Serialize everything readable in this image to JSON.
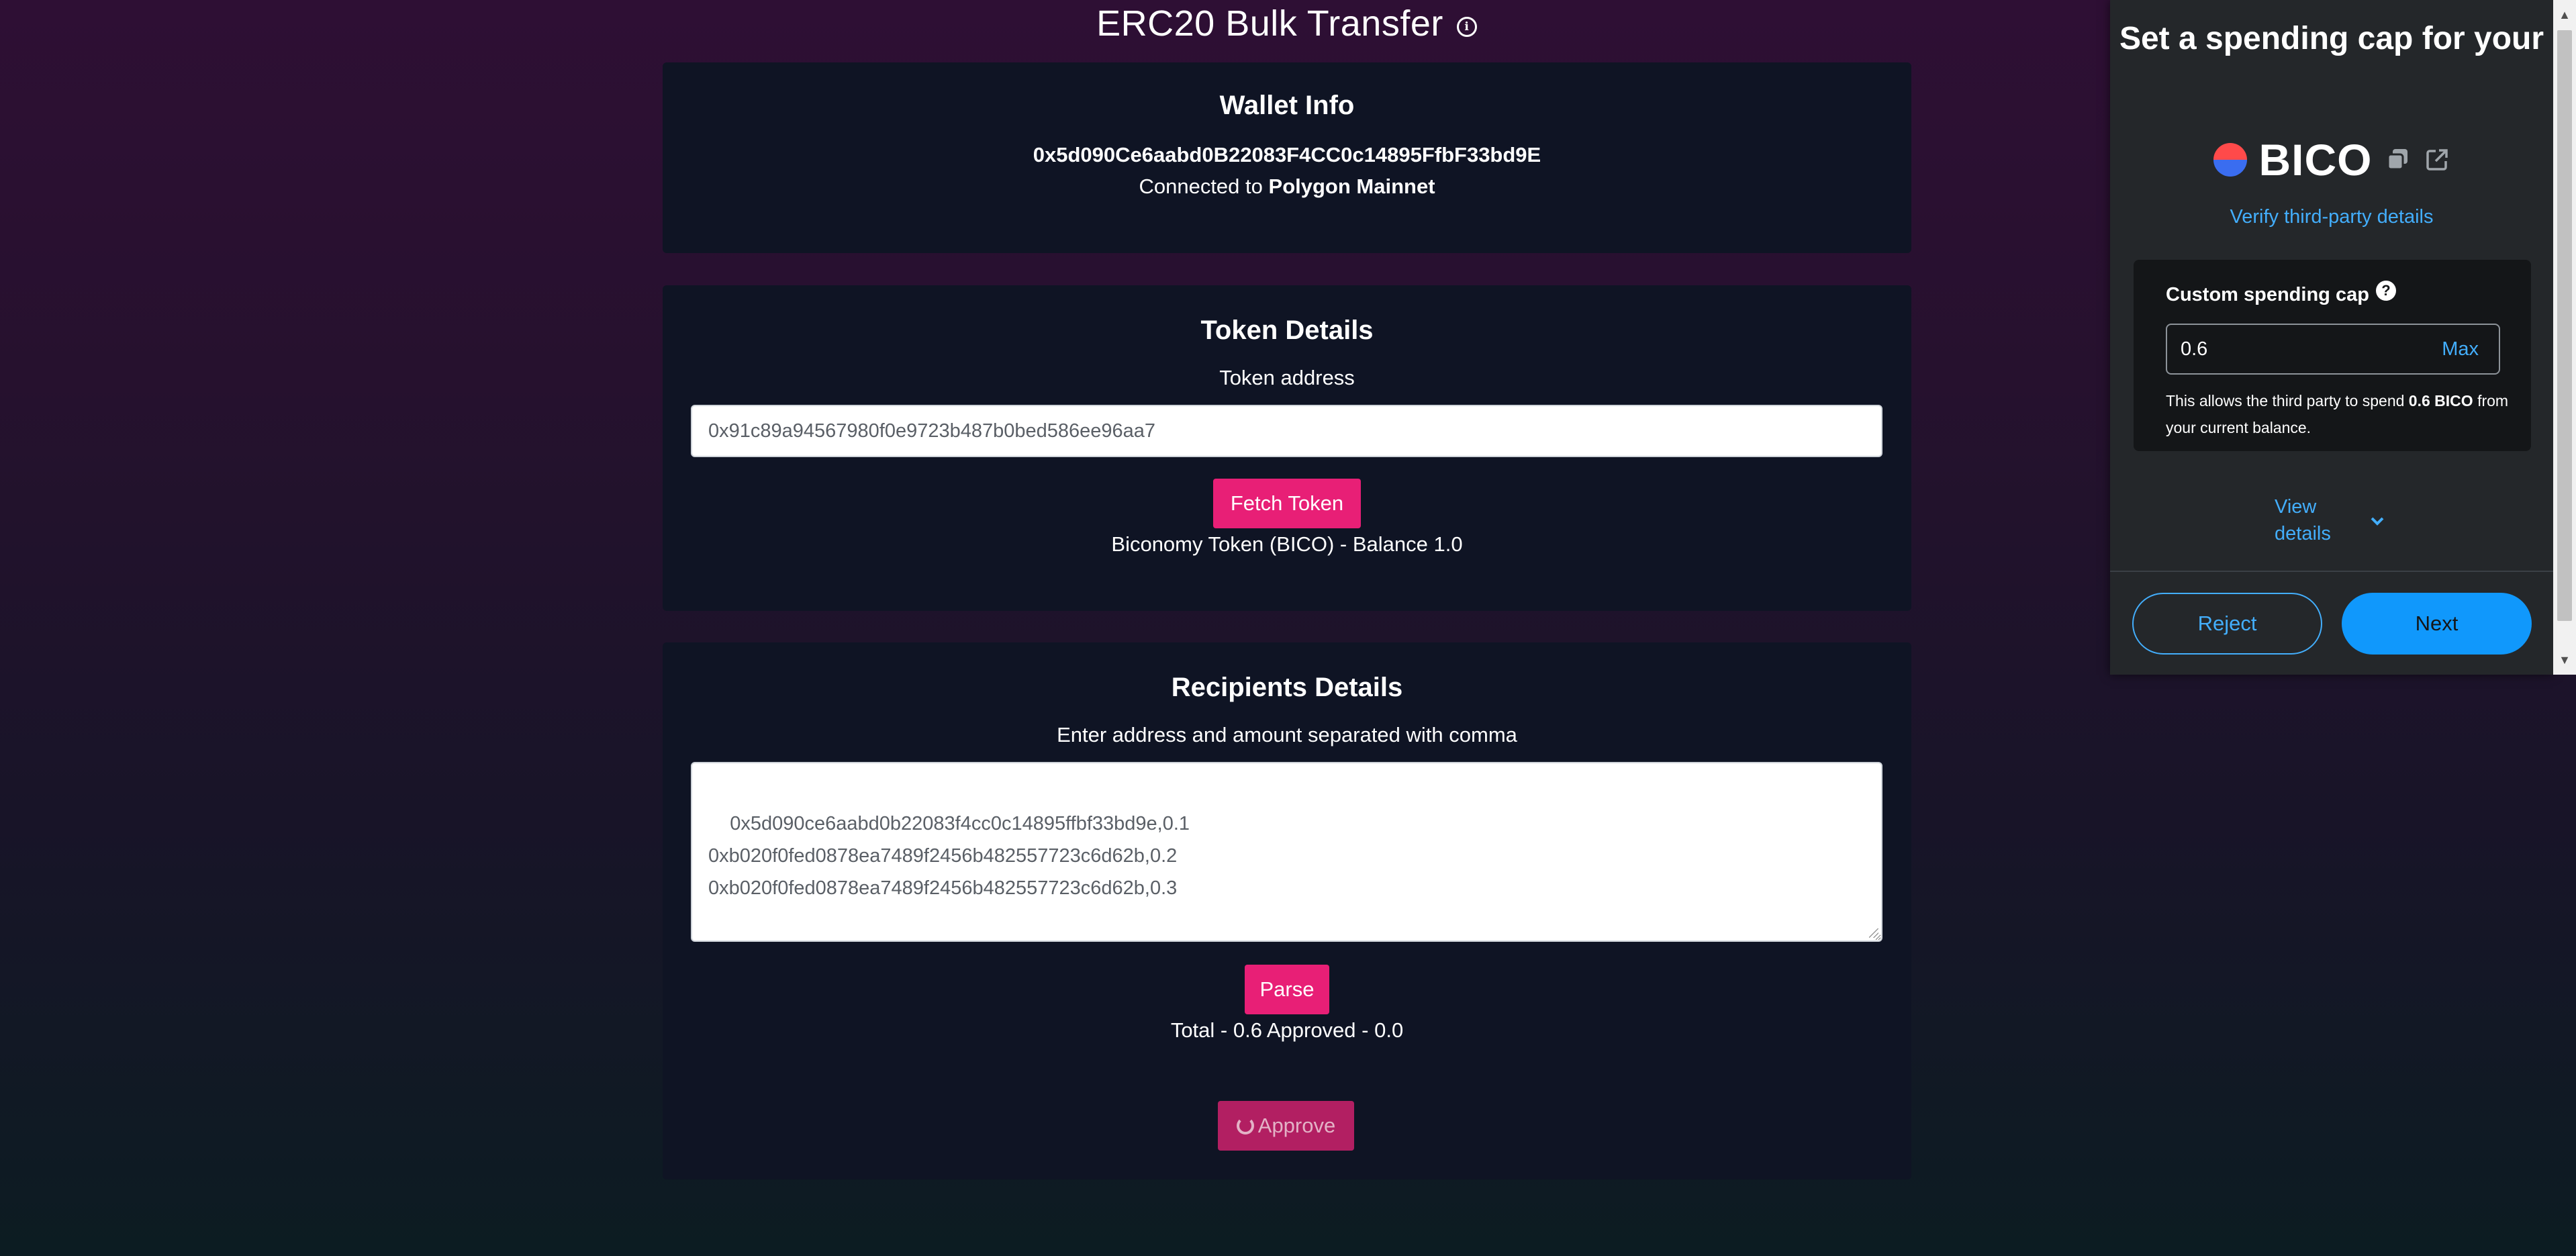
{
  "page": {
    "title": "ERC20 Bulk Transfer",
    "info_icon": "ⓘ"
  },
  "wallet": {
    "heading": "Wallet Info",
    "address": "0x5d090Ce6aabd0B22083F4CC0c14895FfbF33bd9E",
    "connected_prefix": "Connected to",
    "network": "Polygon Mainnet"
  },
  "token": {
    "heading": "Token Details",
    "address_label": "Token address",
    "address_value": "0x91c89a94567980f0e9723b487b0bed586ee96aa7",
    "fetch_button": "Fetch Token",
    "result": "Biconomy Token (BICO) - Balance 1.0"
  },
  "recipients": {
    "heading": "Recipients Details",
    "instructions": "Enter address and amount separated with comma",
    "text": "0x5d090ce6aabd0b22083f4cc0c14895ffbf33bd9e,0.1\n0xb020f0fed0878ea7489f2456b482557723c6d62b,0.2\n0xb020f0fed0878ea7489f2456b482557723c6d62b,0.3",
    "parse_button": "Parse",
    "totals": "Total - 0.6  Approved - 0.0",
    "approve_button": "Approve"
  },
  "metamask": {
    "title": "Set a spending cap for your",
    "token_symbol": "BICO",
    "verify_link": "Verify third-party details",
    "cap_label": "Custom spending cap",
    "cap_help_icon": "?",
    "cap_value": "0.6",
    "max_label": "Max",
    "desc_prefix": "This allows the third party to spend",
    "desc_amount": "0.6 BICO",
    "desc_suffix": "from your current balance.",
    "view_details": "View details",
    "reject_button": "Reject",
    "next_button": "Next",
    "accent_color": "#43aefc",
    "icons": [
      "token-logo",
      "copy-icon",
      "external-link-icon",
      "chevron-down-icon"
    ]
  },
  "colors": {
    "primary_pink": "#e81f76",
    "card_background": "#0f1424",
    "metamask_background": "#24272a"
  }
}
